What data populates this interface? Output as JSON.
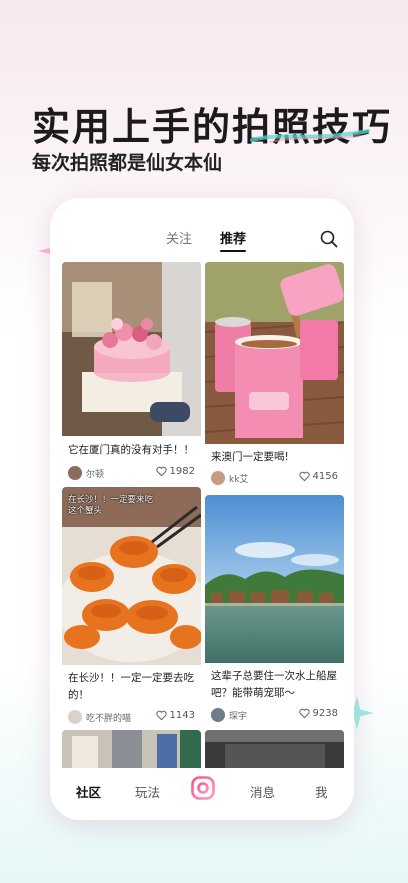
{
  "hero": {
    "title": "实用上手的拍照技巧",
    "subtitle": "每次拍照都是仙女本仙"
  },
  "colors": {
    "accent_pink": "#ff5a8f",
    "accent_teal": "#4fd6cc",
    "text_dark": "#1a1a1a"
  },
  "topbar": {
    "tabs": [
      {
        "label": "关注",
        "active": false
      },
      {
        "label": "推荐",
        "active": true
      }
    ],
    "search_icon": "search-icon"
  },
  "feed": {
    "cards": [
      {
        "title": "它在厦门真的没有对手！！",
        "author": "尔顿",
        "likes": "1982",
        "image": "cake-photo"
      },
      {
        "title": "来澳门一定要喝!",
        "author": "kk艾",
        "likes": "4156",
        "image": "milk-tea-photo"
      },
      {
        "title": "在长沙！！一定一定要去吃的！",
        "author": "吃不胖的喵",
        "likes": "1143",
        "image": "crab-photo",
        "overlay": "在长沙！！一定要来吃这个蟹头"
      },
      {
        "title": "这辈子总要住一次水上船屋吧？能带萌宠耶～",
        "author": "琛宇",
        "likes": "9238",
        "image": "lake-houses-photo"
      }
    ]
  },
  "bottom_nav": {
    "items": [
      {
        "label": "社区",
        "active": true
      },
      {
        "label": "玩法",
        "active": false
      },
      {
        "label": "消息",
        "active": false
      },
      {
        "label": "我",
        "active": false
      }
    ],
    "center_icon": "camera-icon"
  }
}
